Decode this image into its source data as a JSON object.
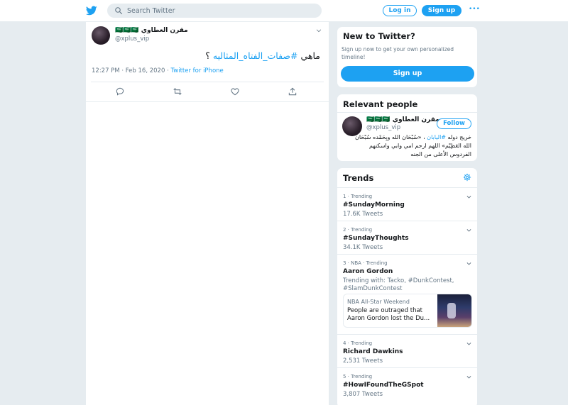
{
  "topbar": {
    "search_placeholder": "Search Twitter",
    "login_label": "Log in",
    "signup_label": "Sign up",
    "more_label": "•••"
  },
  "tweet": {
    "author_name": "مقرن العطاوي 🇸🇦🇸🇦🇸🇦",
    "author_handle": "@xplus_vip",
    "text_prefix": "ماهي ",
    "hashtag": "#صفات_الفتاه_المثاليه",
    "text_suffix": " ؟",
    "time": "12:27 PM · Feb 16, 2020 · ",
    "source": "Twitter for iPhone"
  },
  "new_to_twitter": {
    "title": "New to Twitter?",
    "subtitle": "Sign up now to get your own personalized timeline!",
    "button": "Sign up"
  },
  "relevant": {
    "title": "Relevant people",
    "name": "مقرن العطاوي 🇸🇦🇸🇦🇸🇦",
    "handle": "@xplus_vip",
    "follow": "Follow",
    "bio_1": "خريج دوله ",
    "bio_tag": "#اليابان",
    "bio_2": " ، «سُبْحَان الله وبِحَمْده سُبْحَان الله العَظِيْم» اللهم ارحم امي وابي واسكنهم الفردوس الأعلى من الجنه"
  },
  "trends": {
    "title": "Trends",
    "items": [
      {
        "meta": "1 · Trending",
        "name": "#SundayMorning",
        "count": "17.6K Tweets"
      },
      {
        "meta": "2 · Trending",
        "name": "#SundayThoughts",
        "count": "34.1K Tweets"
      },
      {
        "meta": "3 · NBA · Trending",
        "name": "Aaron Gordon",
        "with": "Trending with: Tacko, #DunkContest, #SlamDunkContest",
        "news_source": "NBA All-Star Weekend",
        "news_title": "People are outraged that Aaron Gordon lost the Du..."
      },
      {
        "meta": "4 · Trending",
        "name": "Richard Dawkins",
        "count": "2,531 Tweets"
      },
      {
        "meta": "5 · Trending",
        "name": "#HowIFoundTheGSpot",
        "count": "3,807 Tweets"
      }
    ]
  },
  "colors": {
    "accent": "#1da1f2",
    "background": "#e6ecf0",
    "text_secondary": "#657786"
  },
  "icons": [
    "twitter-logo-icon",
    "search-icon",
    "chevron-down-icon",
    "reply-icon",
    "retweet-icon",
    "like-icon",
    "share-icon",
    "gear-icon"
  ]
}
